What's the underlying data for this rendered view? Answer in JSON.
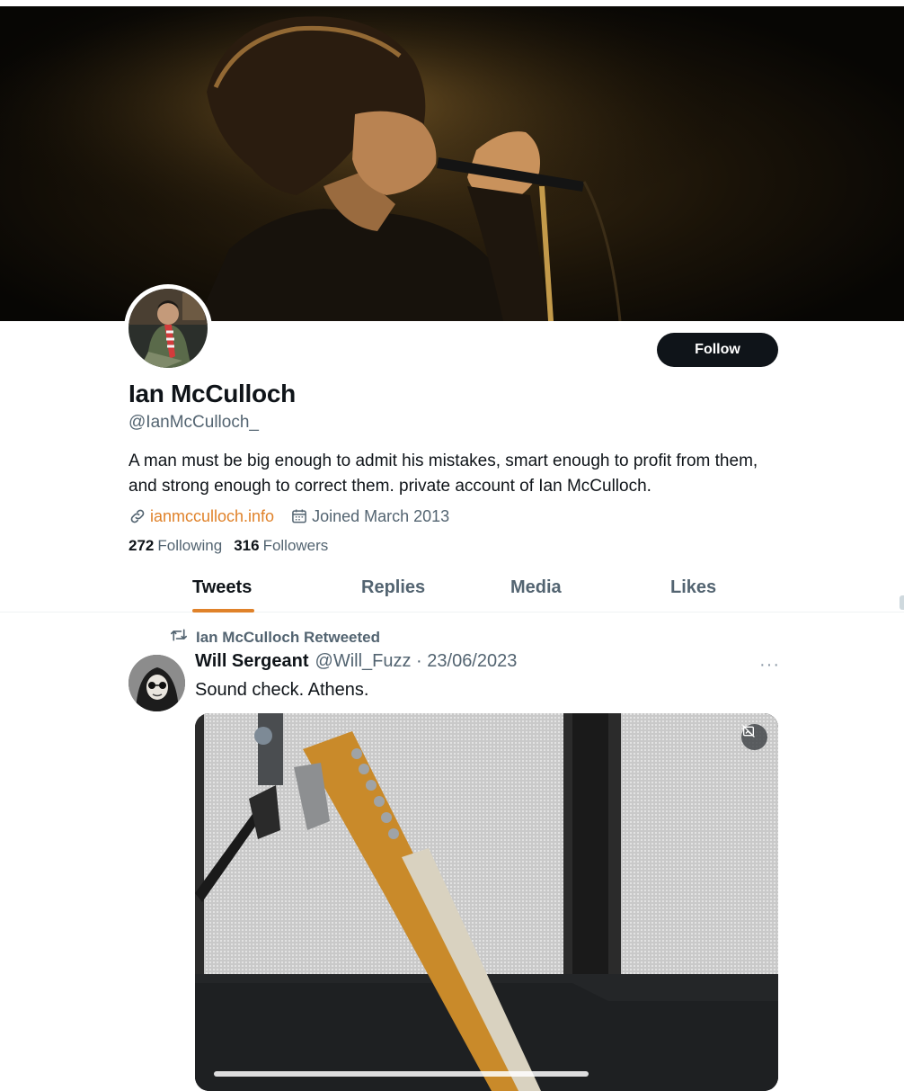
{
  "profile": {
    "name": "Ian McCulloch",
    "handle": "@IanMcCulloch_",
    "bio": "A man must be big enough to admit his mistakes, smart enough to profit from them, and strong enough to correct them. private account of Ian McCulloch.",
    "website": "ianmcculloch.info",
    "joined": "Joined March 2013",
    "following_count": "272",
    "following_label": "Following",
    "followers_count": "316",
    "followers_label": "Followers",
    "follow_button": "Follow"
  },
  "tabs": [
    {
      "label": "Tweets",
      "active": true
    },
    {
      "label": "Replies",
      "active": false
    },
    {
      "label": "Media",
      "active": false
    },
    {
      "label": "Likes",
      "active": false
    }
  ],
  "tweet": {
    "retweet_label": "Ian McCulloch Retweeted",
    "author": "Will Sergeant",
    "meta": "@Will_Fuzz · 23/06/2023",
    "text": "Sound check. Athens.",
    "more_label": "···"
  },
  "icons": {
    "link": "link-icon",
    "calendar": "calendar-icon",
    "retweet": "retweet-icon",
    "more": "more-icon",
    "media_badge": "media-content-warning-icon"
  },
  "colors": {
    "accent": "#e0822a",
    "text_primary": "#0f1419",
    "text_secondary": "#536471",
    "button_bg": "#0f1419"
  }
}
